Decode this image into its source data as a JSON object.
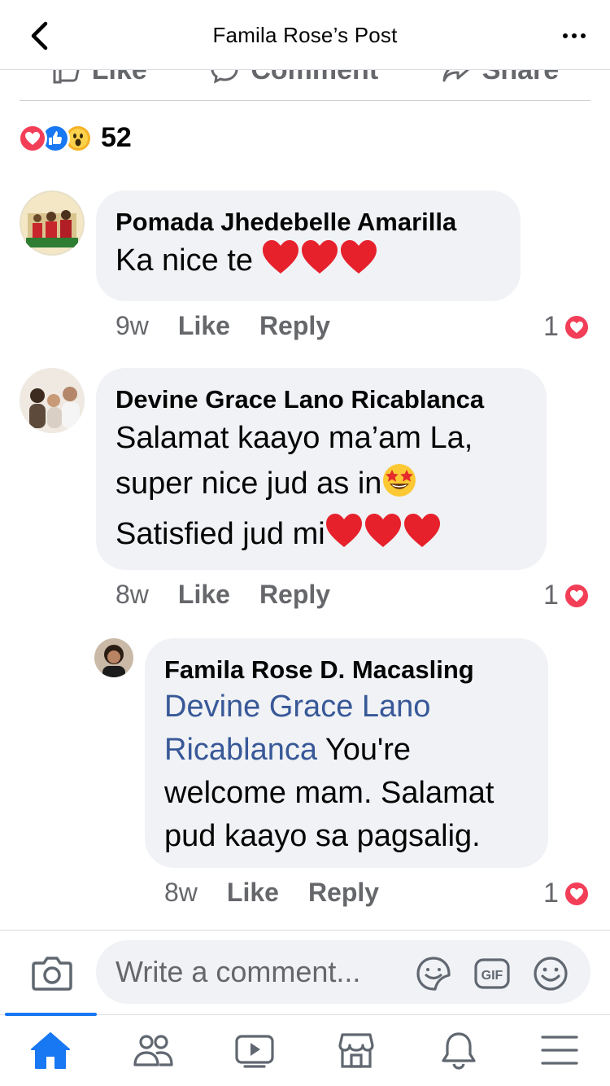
{
  "header": {
    "title": "Famila Rose’s Post"
  },
  "actions": [
    {
      "label": "Like",
      "icon": "thumbs-up-icon"
    },
    {
      "label": "Comment",
      "icon": "comment-bubble-icon"
    },
    {
      "label": "Share",
      "icon": "share-arrow-icon"
    }
  ],
  "reactions": {
    "types": [
      "love",
      "like",
      "wow"
    ],
    "count": "52"
  },
  "comments": [
    {
      "author": "Pomada Jhedebelle Amarilla",
      "text": "Ka nice te",
      "time": "9w",
      "like_label": "Like",
      "reply_label": "Reply",
      "likes": "1"
    },
    {
      "author": "Devine Grace Lano Ricablanca",
      "line1": "Salamat kaayo ma’am La,",
      "line2": "super nice jud as in",
      "line3": "Satisfied jud mi",
      "time": "8w",
      "like_label": "Like",
      "reply_label": "Reply",
      "likes": "1"
    },
    {
      "author": "Famila Rose D. Macasling",
      "mention": "Devine Grace Lano Ricablanca",
      "text": "You're welcome mam. Salamat pud kaayo sa pagsalig.",
      "time": "8w",
      "like_label": "Like",
      "reply_label": "Reply",
      "likes": "1"
    }
  ],
  "composer": {
    "placeholder": "Write a comment..."
  },
  "colors": {
    "brand": "#1877f2",
    "love": "#f33e58",
    "bubble": "#f0f2f5",
    "muted": "#65676b",
    "mention": "#385898"
  },
  "tabs": [
    {
      "name": "home",
      "icon": "home-icon",
      "active": true
    },
    {
      "name": "friends",
      "icon": "friends-icon"
    },
    {
      "name": "watch",
      "icon": "video-icon"
    },
    {
      "name": "marketplace",
      "icon": "marketplace-icon"
    },
    {
      "name": "notifications",
      "icon": "bell-icon"
    },
    {
      "name": "menu",
      "icon": "hamburger-menu-icon"
    }
  ]
}
